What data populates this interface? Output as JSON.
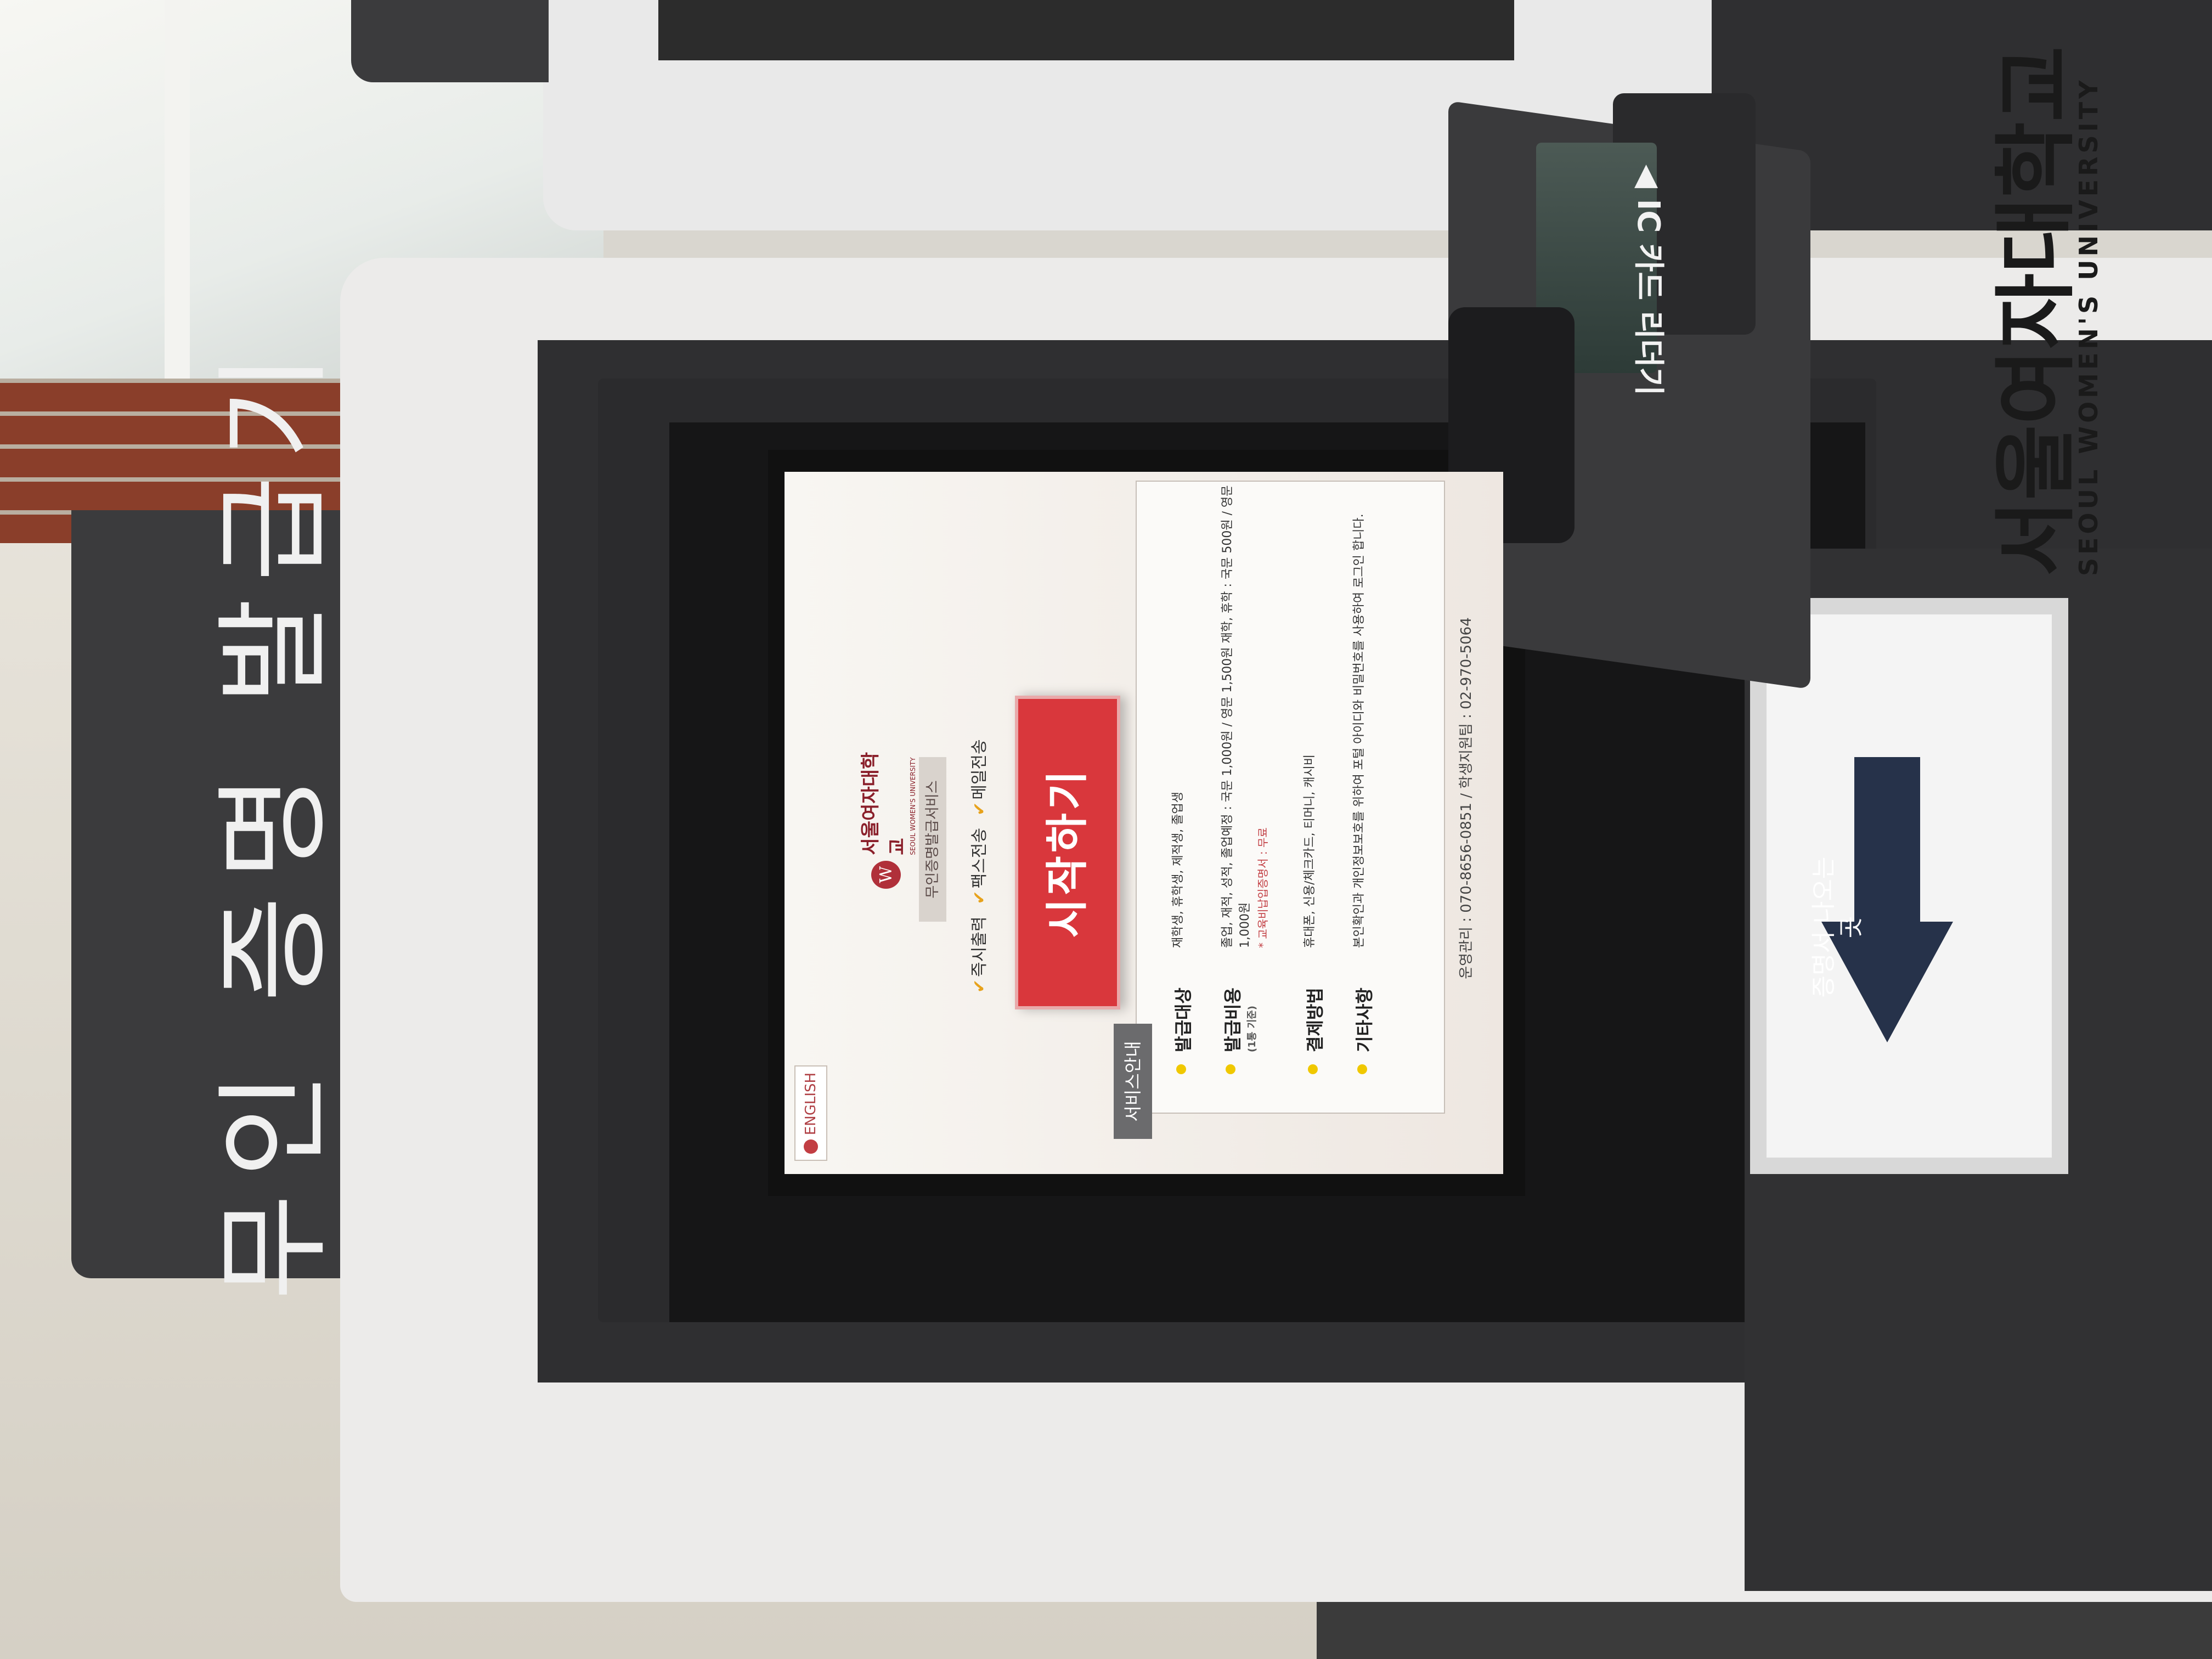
{
  "environment": {
    "side_sign": "무인 증명 발급기"
  },
  "kiosk": {
    "card_reader_label": "◀ IC 카드 리더기",
    "brand_name": "서울여자대학교",
    "brand_name_en": "SEOUL WOMEN'S UNIVERSITY",
    "output_slot_label": "증명서 나오는 곳"
  },
  "screen": {
    "language_button": "ENGLISH",
    "logo": {
      "name": "서울여자대학교",
      "name_en": "SEOUL WOMEN'S UNIVERSITY",
      "mark": "W"
    },
    "service_title": "무인증명발급서비스",
    "features": [
      "즉시출력",
      "팩스전송",
      "메일전송"
    ],
    "start_button": "시작하기",
    "info_tag": "서비스안내",
    "info": [
      {
        "label": "발급대상",
        "sub": "",
        "value": "재학생, 휴학생, 제적생, 졸업생",
        "note": ""
      },
      {
        "label": "발급비용",
        "sub": "(1통 기준)",
        "value": "졸업, 재적, 성적, 졸업예정 : 국문 1,000원 / 영문 1,500원  재학, 휴학 : 국문 500원 / 영문 1,000원",
        "note": "* 교육비납입증명서 : 무료"
      },
      {
        "label": "결제방법",
        "sub": "",
        "value": "휴대폰, 신용/체크카드, 티머니, 캐시비",
        "note": ""
      },
      {
        "label": "기타사항",
        "sub": "",
        "value": "본인확인과 개인정보보호를 위하여 포털 아이디와 비밀번호를 사용하여 로그인 합니다.",
        "note": ""
      }
    ],
    "footer": "운영관리 : 070-8656-0851 / 학생지원팀 : 02-970-5064"
  }
}
